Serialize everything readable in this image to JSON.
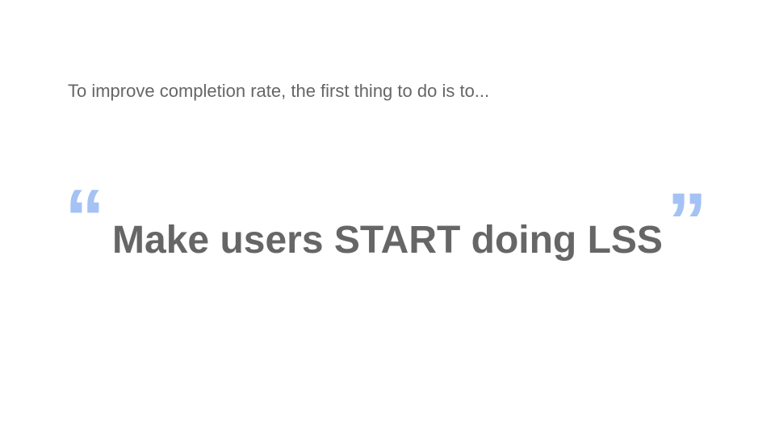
{
  "slide": {
    "intro_text": "To improve completion rate, the first thing to do is to...",
    "quote_open": "“",
    "headline": "Make users START doing LSS",
    "quote_close": "”"
  },
  "colors": {
    "text": "#666666",
    "quote_marks": "#a4c2f4",
    "background": "#ffffff"
  }
}
